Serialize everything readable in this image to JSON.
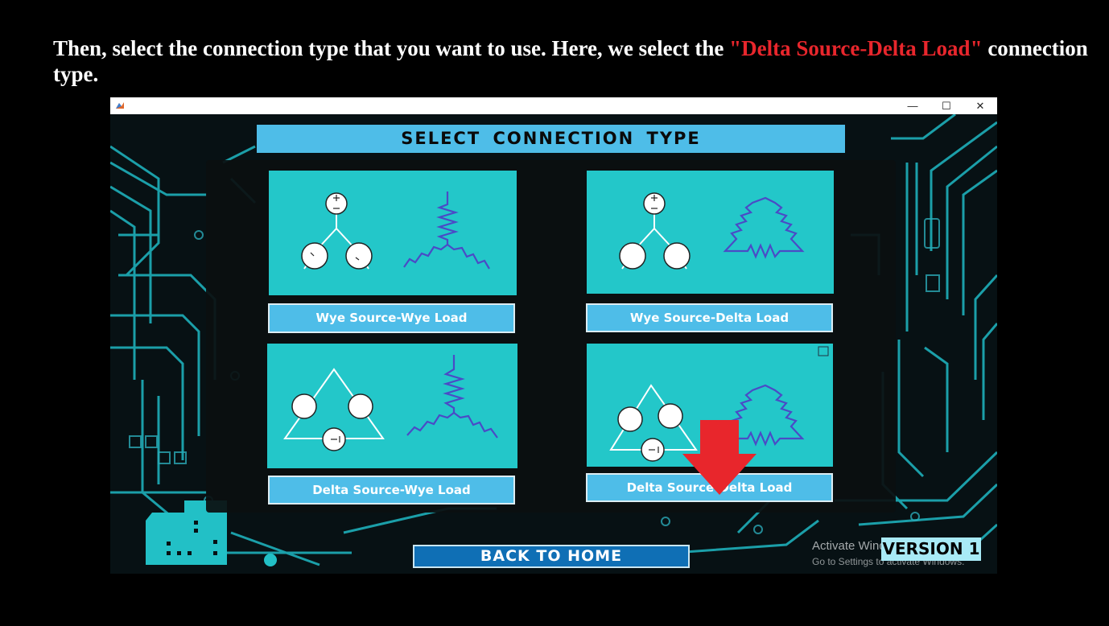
{
  "caption": {
    "text_before": "Then, select the connection type that you want to use. Here, we select the ",
    "highlight": "\"Delta Source-Delta Load\"",
    "text_after": " connection type."
  },
  "window": {
    "title": "",
    "controls": {
      "minimize": "—",
      "maximize": "☐",
      "close": "✕"
    }
  },
  "app": {
    "header": "SELECT CONNECTION TYPE",
    "options": [
      {
        "label": "Wye Source-Wye Load",
        "source": "wye",
        "load": "wye"
      },
      {
        "label": "Wye Source-Delta Load",
        "source": "wye",
        "load": "delta"
      },
      {
        "label": "Delta Source-Wye Load",
        "source": "delta",
        "load": "wye"
      },
      {
        "label": "Delta Source-Delta Load",
        "source": "delta",
        "load": "delta"
      }
    ],
    "back_button": "BACK TO HOME",
    "version": "VERSION 1",
    "watermark_line1": "Activate Windows",
    "watermark_line2": "Go to Settings to activate Windows."
  },
  "colors": {
    "caption_highlight": "#e8262c",
    "header_bg": "#4ebde8",
    "card_bg": "#23c7c9",
    "button_bg": "#4ebde8",
    "back_button_bg": "#0f6fb5",
    "pointer_arrow": "#e8262c"
  },
  "icons": [
    "matlab-figure-icon",
    "red-down-arrow"
  ]
}
